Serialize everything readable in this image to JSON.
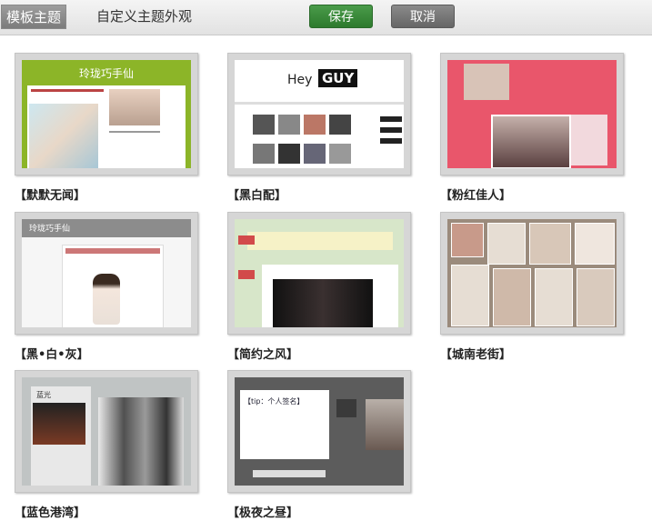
{
  "header": {
    "tab_template": "模板主题",
    "tab_custom": "自定义主题外观",
    "save_label": "保存",
    "cancel_label": "取消"
  },
  "themes": [
    {
      "name": "【默默无闻】",
      "preview_title": "玲珑巧手仙"
    },
    {
      "name": "【黑白配】",
      "preview_title": "Hey",
      "preview_title_2": "GUY"
    },
    {
      "name": "【粉红佳人】"
    },
    {
      "name": "【黑•白•灰】",
      "preview_title": "玲珑巧手仙"
    },
    {
      "name": "【简约之风】"
    },
    {
      "name": "【城南老街】"
    },
    {
      "name": "【蓝色港湾】",
      "preview_title": "蓝光"
    },
    {
      "name": "【极夜之昼】",
      "preview_title": "【tip：个人签名】"
    }
  ],
  "colors": {
    "save": "#2d7a2d",
    "cancel": "#666666",
    "tab_active": "#8a8a8a"
  }
}
